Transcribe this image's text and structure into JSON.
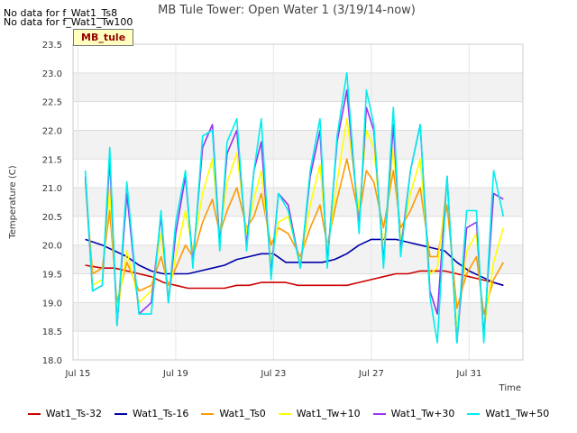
{
  "notes": [
    "No data for f_Wat1_Ts8",
    "No data for f_Wat1_Tw100"
  ],
  "badge": "MB_tule",
  "chart_data": {
    "type": "line",
    "title": "MB Tule Tower: Open Water 1 (3/19/14-now)",
    "xlabel": "Time",
    "ylabel": "Temperature (C)",
    "x_unit": "day of July",
    "xlim": [
      14.8,
      33.2
    ],
    "ylim": [
      18.0,
      23.5
    ],
    "yticks": [
      "18.0",
      "18.5",
      "19.0",
      "19.5",
      "20.0",
      "20.5",
      "21.0",
      "21.5",
      "22.0",
      "22.5",
      "23.0",
      "23.5"
    ],
    "xticks": [
      {
        "x": 15,
        "label": "Jul 15"
      },
      {
        "x": 19,
        "label": "Jul 19"
      },
      {
        "x": 23,
        "label": "Jul 23"
      },
      {
        "x": 27,
        "label": "Jul 27"
      },
      {
        "x": 31,
        "label": "Jul 31"
      }
    ],
    "grid": true,
    "legend_position": "bottom",
    "series": [
      {
        "name": "Wat1_Ts-32",
        "color": "#cc0000",
        "x": [
          15.3,
          16.0,
          16.5,
          17.0,
          17.5,
          18.0,
          18.5,
          19.0,
          19.5,
          20.0,
          20.5,
          21.0,
          21.5,
          22.0,
          22.5,
          23.0,
          23.5,
          24.0,
          24.5,
          25.0,
          25.5,
          26.0,
          26.5,
          27.0,
          27.5,
          28.0,
          28.5,
          29.0,
          29.5,
          30.0,
          30.5,
          31.0,
          31.5,
          32.0,
          32.4
        ],
        "y": [
          19.65,
          19.6,
          19.6,
          19.55,
          19.5,
          19.45,
          19.35,
          19.3,
          19.25,
          19.25,
          19.25,
          19.25,
          19.3,
          19.3,
          19.35,
          19.35,
          19.35,
          19.3,
          19.3,
          19.3,
          19.3,
          19.3,
          19.35,
          19.4,
          19.45,
          19.5,
          19.5,
          19.55,
          19.55,
          19.55,
          19.5,
          19.45,
          19.4,
          19.35,
          19.3
        ]
      },
      {
        "name": "Wat1_Ts-16",
        "color": "#0000aa",
        "x": [
          15.3,
          16.0,
          16.5,
          17.0,
          17.5,
          18.0,
          18.5,
          19.0,
          19.5,
          20.0,
          20.5,
          21.0,
          21.5,
          22.0,
          22.5,
          23.0,
          23.5,
          24.0,
          24.5,
          25.0,
          25.5,
          26.0,
          26.5,
          27.0,
          27.5,
          28.0,
          28.5,
          29.0,
          29.5,
          30.0,
          30.5,
          31.0,
          31.5,
          32.0,
          32.4
        ],
        "y": [
          20.1,
          20.0,
          19.9,
          19.8,
          19.65,
          19.55,
          19.5,
          19.5,
          19.5,
          19.55,
          19.6,
          19.65,
          19.75,
          19.8,
          19.85,
          19.85,
          19.7,
          19.7,
          19.7,
          19.7,
          19.75,
          19.85,
          20.0,
          20.1,
          20.1,
          20.1,
          20.05,
          20.0,
          19.95,
          19.9,
          19.7,
          19.55,
          19.45,
          19.35,
          19.3
        ]
      },
      {
        "name": "Wat1_Ts0",
        "color": "#ff9900",
        "x": [
          15.3,
          15.6,
          16.0,
          16.3,
          16.6,
          17.0,
          17.5,
          18.0,
          18.4,
          18.7,
          19.0,
          19.4,
          19.7,
          20.1,
          20.5,
          20.8,
          21.1,
          21.5,
          21.9,
          22.2,
          22.5,
          22.9,
          23.2,
          23.6,
          24.1,
          24.5,
          24.9,
          25.2,
          25.6,
          26.0,
          26.5,
          26.8,
          27.1,
          27.5,
          27.9,
          28.2,
          28.6,
          29.0,
          29.4,
          29.7,
          30.1,
          30.5,
          30.9,
          31.3,
          31.6,
          32.0,
          32.4
        ],
        "y": [
          21.1,
          19.5,
          19.6,
          20.6,
          19.0,
          19.7,
          19.2,
          19.3,
          19.8,
          19.3,
          19.6,
          20.0,
          19.8,
          20.4,
          20.8,
          20.2,
          20.6,
          21.0,
          20.3,
          20.5,
          20.9,
          20.0,
          20.3,
          20.2,
          19.8,
          20.3,
          20.7,
          20.0,
          20.8,
          21.5,
          20.5,
          21.3,
          21.1,
          20.3,
          21.3,
          20.3,
          20.6,
          21.0,
          19.8,
          19.8,
          20.7,
          18.9,
          19.5,
          19.8,
          18.8,
          19.4,
          19.7
        ]
      },
      {
        "name": "Wat1_Tw+10",
        "color": "#ffff00",
        "x": [
          15.3,
          15.6,
          16.0,
          16.3,
          16.6,
          17.0,
          17.5,
          18.0,
          18.4,
          18.7,
          19.0,
          19.4,
          19.7,
          20.1,
          20.5,
          20.8,
          21.1,
          21.5,
          21.9,
          22.2,
          22.5,
          22.9,
          23.2,
          23.6,
          24.1,
          24.5,
          24.9,
          25.2,
          25.6,
          26.0,
          26.5,
          26.8,
          27.1,
          27.5,
          27.9,
          28.2,
          28.6,
          29.0,
          29.4,
          29.7,
          30.1,
          30.5,
          30.9,
          31.3,
          31.6,
          32.0,
          32.4
        ],
        "y": [
          21.1,
          19.3,
          19.4,
          21.0,
          18.8,
          19.9,
          19.0,
          19.2,
          20.2,
          19.1,
          19.8,
          20.6,
          19.9,
          20.9,
          21.5,
          20.2,
          21.1,
          21.6,
          20.2,
          20.8,
          21.3,
          19.7,
          20.4,
          20.5,
          19.7,
          20.7,
          21.4,
          19.9,
          21.1,
          22.2,
          20.6,
          22.0,
          21.7,
          19.9,
          21.7,
          20.1,
          20.9,
          21.5,
          19.5,
          19.6,
          21.1,
          18.5,
          19.9,
          20.2,
          18.5,
          19.7,
          20.3
        ]
      },
      {
        "name": "Wat1_Tw+30",
        "color": "#9933ee",
        "x": [
          15.3,
          15.6,
          16.0,
          16.3,
          16.6,
          17.0,
          17.5,
          18.0,
          18.4,
          18.7,
          19.0,
          19.4,
          19.7,
          20.1,
          20.5,
          20.8,
          21.1,
          21.5,
          21.9,
          22.2,
          22.5,
          22.9,
          23.2,
          23.6,
          24.1,
          24.5,
          24.9,
          25.2,
          25.6,
          26.0,
          26.5,
          26.8,
          27.1,
          27.5,
          27.9,
          28.2,
          28.6,
          29.0,
          29.4,
          29.7,
          30.1,
          30.5,
          30.9,
          31.3,
          31.6,
          32.0,
          32.4
        ],
        "y": [
          21.2,
          19.2,
          19.3,
          21.5,
          18.6,
          20.9,
          18.8,
          19.0,
          20.5,
          19.0,
          20.2,
          21.2,
          19.7,
          21.7,
          22.1,
          20.0,
          21.6,
          22.0,
          20.0,
          21.3,
          21.8,
          19.5,
          20.9,
          20.7,
          19.6,
          21.2,
          22.0,
          19.7,
          21.8,
          22.7,
          20.3,
          22.4,
          22.0,
          19.7,
          22.1,
          19.9,
          21.3,
          22.1,
          19.2,
          18.8,
          21.2,
          18.3,
          20.3,
          20.4,
          18.4,
          20.9,
          20.8
        ]
      },
      {
        "name": "Wat1_Tw+50",
        "color": "#00eeee",
        "x": [
          15.3,
          15.6,
          16.0,
          16.3,
          16.6,
          17.0,
          17.5,
          18.0,
          18.4,
          18.7,
          19.0,
          19.4,
          19.7,
          20.1,
          20.5,
          20.8,
          21.1,
          21.5,
          21.9,
          22.2,
          22.5,
          22.9,
          23.2,
          23.6,
          24.1,
          24.5,
          24.9,
          25.2,
          25.6,
          26.0,
          26.5,
          26.8,
          27.1,
          27.5,
          27.9,
          28.2,
          28.6,
          29.0,
          29.4,
          29.7,
          30.1,
          30.5,
          30.9,
          31.3,
          31.6,
          32.0,
          32.4
        ],
        "y": [
          21.3,
          19.2,
          19.3,
          21.7,
          18.6,
          21.1,
          18.8,
          18.8,
          20.6,
          19.0,
          20.4,
          21.3,
          19.6,
          21.9,
          22.0,
          19.9,
          21.8,
          22.2,
          19.9,
          21.3,
          22.2,
          19.4,
          20.9,
          20.6,
          19.6,
          21.3,
          22.2,
          19.6,
          21.9,
          23.0,
          20.2,
          22.7,
          22.1,
          19.6,
          22.4,
          19.8,
          21.3,
          22.1,
          19.1,
          18.3,
          21.2,
          18.3,
          20.6,
          20.6,
          18.3,
          21.3,
          20.5
        ]
      }
    ]
  }
}
